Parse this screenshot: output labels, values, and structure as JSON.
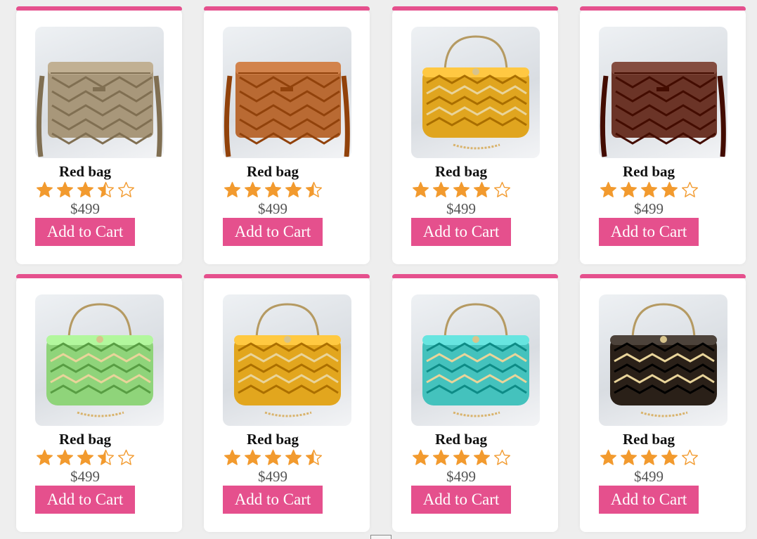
{
  "products": [
    {
      "name": "Red bag",
      "price": "$499",
      "button_label": "Add to Cart",
      "rating": 3.5,
      "bag_color": "#a8977a",
      "bag_style": "crossbody"
    },
    {
      "name": "Red bag",
      "price": "$499",
      "button_label": "Add to Cart",
      "rating": 4.5,
      "bag_color": "#b96a33",
      "bag_style": "crossbody"
    },
    {
      "name": "Red bag",
      "price": "$499",
      "button_label": "Add to Cart",
      "rating": 4,
      "bag_color": "#e0a51f",
      "bag_style": "clutch"
    },
    {
      "name": "Red bag",
      "price": "$499",
      "button_label": "Add to Cart",
      "rating": 4,
      "bag_color": "#6b3427",
      "bag_style": "crossbody"
    },
    {
      "name": "Red bag",
      "price": "$499",
      "button_label": "Add to Cart",
      "rating": 3.5,
      "bag_color": "#8fd47a",
      "bag_style": "clutch"
    },
    {
      "name": "Red bag",
      "price": "$499",
      "button_label": "Add to Cart",
      "rating": 4.5,
      "bag_color": "#e2a61e",
      "bag_style": "clutch"
    },
    {
      "name": "Red bag",
      "price": "$499",
      "button_label": "Add to Cart",
      "rating": 4,
      "bag_color": "#44c2bd",
      "bag_style": "clutch"
    },
    {
      "name": "Red bag",
      "price": "$499",
      "button_label": "Add to Cart",
      "rating": 4,
      "bag_color": "#2a2018",
      "bag_style": "clutch"
    }
  ],
  "colors": {
    "accent": "#e5508d",
    "star": "#f29a2e"
  }
}
